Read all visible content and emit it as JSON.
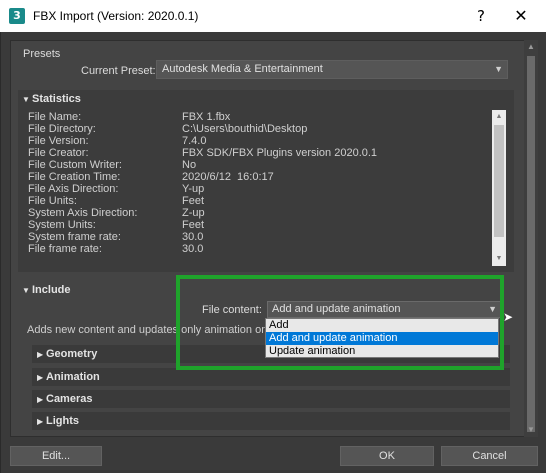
{
  "window": {
    "app_icon": "3",
    "title": "FBX Import (Version: 2020.0.1)",
    "help": "?",
    "close": "✕"
  },
  "presets": {
    "group_label": "Presets",
    "current_preset_label": "Current Preset:",
    "current_preset_value": "Autodesk Media & Entertainment"
  },
  "statistics": {
    "header": "Statistics",
    "rows": [
      {
        "label": "File Name:",
        "value": "FBX 1.fbx"
      },
      {
        "label": "File Directory:",
        "value": "C:\\Users\\bouthid\\Desktop"
      },
      {
        "label": "File Version:",
        "value": "7.4.0"
      },
      {
        "label": "File Creator:",
        "value": "FBX SDK/FBX Plugins version 2020.0.1"
      },
      {
        "label": "File Custom Writer:",
        "value": "No"
      },
      {
        "label": "File Creation Time:",
        "value": "2020/6/12  16:0:17"
      },
      {
        "label": "File Axis Direction:",
        "value": "Y-up"
      },
      {
        "label": "File Units:",
        "value": "Feet"
      },
      {
        "label": "System Axis Direction:",
        "value": "Z-up"
      },
      {
        "label": "System Units:",
        "value": "Feet"
      },
      {
        "label": "System frame rate:",
        "value": "30.0"
      },
      {
        "label": "File frame rate:",
        "value": "30.0"
      }
    ]
  },
  "include": {
    "header": "Include",
    "file_content_label": "File content:",
    "file_content_value": "Add and update animation",
    "description": "Adds new content and updates only animation on m",
    "dropdown_options": [
      {
        "label": "Add",
        "selected": false
      },
      {
        "label": "Add and update animation",
        "selected": true
      },
      {
        "label": "Update animation",
        "selected": false
      }
    ],
    "subsections": [
      "Geometry",
      "Animation",
      "Cameras",
      "Lights"
    ]
  },
  "buttons": {
    "edit": "Edit...",
    "ok": "OK",
    "cancel": "Cancel"
  },
  "colors": {
    "highlight": "#1fa32b",
    "selection": "#0078d7"
  }
}
